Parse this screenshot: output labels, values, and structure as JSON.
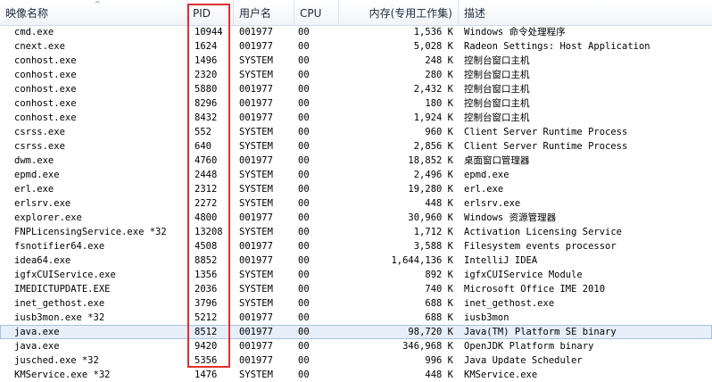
{
  "columns": {
    "name": "映像名称",
    "pid": "PID",
    "user": "用户名",
    "cpu": "CPU",
    "memory": "内存(专用工作集)",
    "description": "描述"
  },
  "sort_indicator": "^",
  "colors": {
    "highlight_box": "#e03131",
    "selected_row": "#e6eef8"
  },
  "rows": [
    {
      "name": "cmd.exe",
      "pid": "10944",
      "user": "001977",
      "cpu": "00",
      "mem": "1,536 K",
      "desc": "Windows 命令处理程序"
    },
    {
      "name": "cnext.exe",
      "pid": "1624",
      "user": "001977",
      "cpu": "00",
      "mem": "5,028 K",
      "desc": "Radeon Settings: Host Application"
    },
    {
      "name": "conhost.exe",
      "pid": "1496",
      "user": "SYSTEM",
      "cpu": "00",
      "mem": "248 K",
      "desc": "控制台窗口主机"
    },
    {
      "name": "conhost.exe",
      "pid": "2320",
      "user": "SYSTEM",
      "cpu": "00",
      "mem": "280 K",
      "desc": "控制台窗口主机"
    },
    {
      "name": "conhost.exe",
      "pid": "5880",
      "user": "001977",
      "cpu": "00",
      "mem": "2,432 K",
      "desc": "控制台窗口主机"
    },
    {
      "name": "conhost.exe",
      "pid": "8296",
      "user": "001977",
      "cpu": "00",
      "mem": "180 K",
      "desc": "控制台窗口主机"
    },
    {
      "name": "conhost.exe",
      "pid": "8432",
      "user": "001977",
      "cpu": "00",
      "mem": "1,924 K",
      "desc": "控制台窗口主机"
    },
    {
      "name": "csrss.exe",
      "pid": "552",
      "user": "SYSTEM",
      "cpu": "00",
      "mem": "960 K",
      "desc": "Client Server Runtime Process"
    },
    {
      "name": "csrss.exe",
      "pid": "640",
      "user": "SYSTEM",
      "cpu": "00",
      "mem": "2,856 K",
      "desc": "Client Server Runtime Process"
    },
    {
      "name": "dwm.exe",
      "pid": "4760",
      "user": "001977",
      "cpu": "00",
      "mem": "18,852 K",
      "desc": "桌面窗口管理器"
    },
    {
      "name": "epmd.exe",
      "pid": "2448",
      "user": "SYSTEM",
      "cpu": "00",
      "mem": "2,496 K",
      "desc": "epmd.exe"
    },
    {
      "name": "erl.exe",
      "pid": "2312",
      "user": "SYSTEM",
      "cpu": "00",
      "mem": "19,280 K",
      "desc": "erl.exe"
    },
    {
      "name": "erlsrv.exe",
      "pid": "2272",
      "user": "SYSTEM",
      "cpu": "00",
      "mem": "448 K",
      "desc": "erlsrv.exe"
    },
    {
      "name": "explorer.exe",
      "pid": "4800",
      "user": "001977",
      "cpu": "00",
      "mem": "30,960 K",
      "desc": "Windows 资源管理器"
    },
    {
      "name": "FNPLicensingService.exe *32",
      "pid": "13208",
      "user": "SYSTEM",
      "cpu": "00",
      "mem": "1,712 K",
      "desc": "Activation Licensing Service"
    },
    {
      "name": "fsnotifier64.exe",
      "pid": "4508",
      "user": "001977",
      "cpu": "00",
      "mem": "3,588 K",
      "desc": "Filesystem events processor"
    },
    {
      "name": "idea64.exe",
      "pid": "8852",
      "user": "001977",
      "cpu": "00",
      "mem": "1,644,136 K",
      "desc": "IntelliJ IDEA"
    },
    {
      "name": "igfxCUIService.exe",
      "pid": "1356",
      "user": "SYSTEM",
      "cpu": "00",
      "mem": "892 K",
      "desc": "igfxCUIService Module"
    },
    {
      "name": "IMEDICTUPDATE.EXE",
      "pid": "2036",
      "user": "SYSTEM",
      "cpu": "00",
      "mem": "740 K",
      "desc": "Microsoft Office IME 2010"
    },
    {
      "name": "inet_gethost.exe",
      "pid": "3796",
      "user": "SYSTEM",
      "cpu": "00",
      "mem": "688 K",
      "desc": "inet_gethost.exe"
    },
    {
      "name": "iusb3mon.exe *32",
      "pid": "5212",
      "user": "001977",
      "cpu": "00",
      "mem": "688 K",
      "desc": "iusb3mon"
    },
    {
      "name": "java.exe",
      "pid": "8512",
      "user": "001977",
      "cpu": "00",
      "mem": "98,720 K",
      "desc": "Java(TM) Platform SE binary"
    },
    {
      "name": "java.exe",
      "pid": "9420",
      "user": "001977",
      "cpu": "00",
      "mem": "346,968 K",
      "desc": "OpenJDK Platform binary"
    },
    {
      "name": "jusched.exe *32",
      "pid": "5356",
      "user": "001977",
      "cpu": "00",
      "mem": "996 K",
      "desc": "Java Update Scheduler"
    },
    {
      "name": "KMService.exe *32",
      "pid": "1476",
      "user": "SYSTEM",
      "cpu": "00",
      "mem": "448 K",
      "desc": "KMService.exe"
    }
  ]
}
